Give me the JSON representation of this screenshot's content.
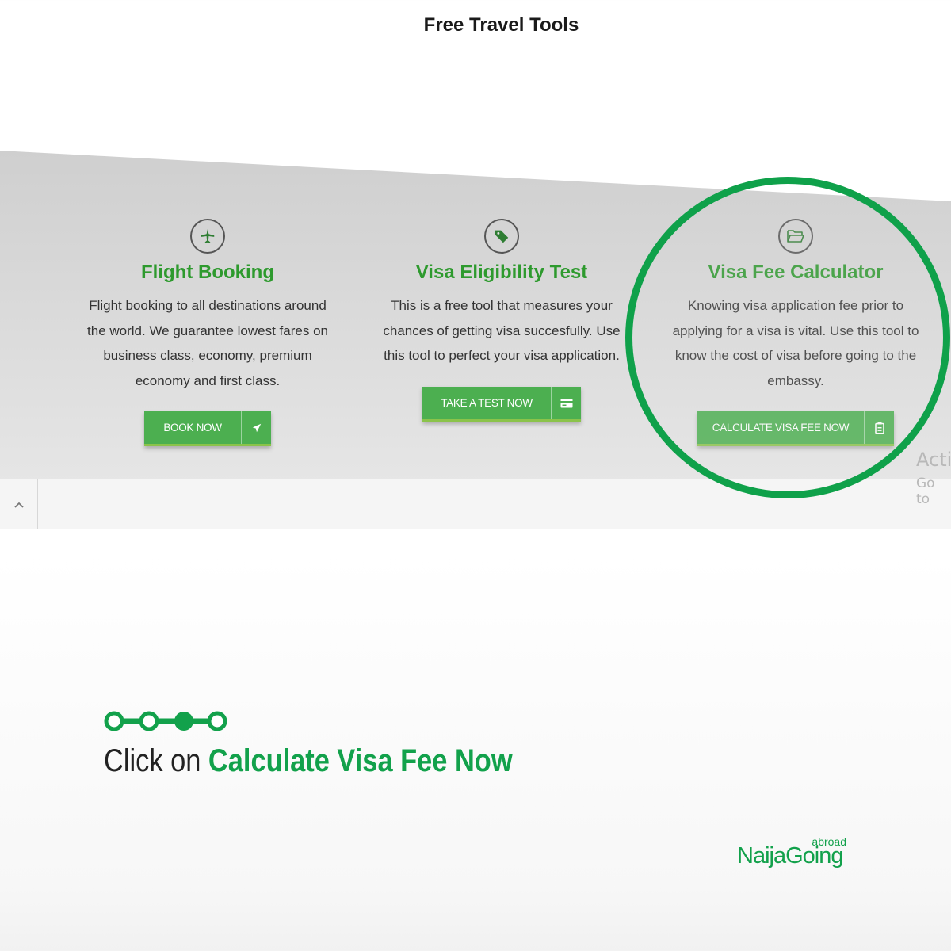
{
  "page": {
    "title": "Free Travel Tools"
  },
  "cards": [
    {
      "title": "Flight Booking",
      "description": "Flight booking to all destinations around\nthe world. We guarantee lowest fares on\nbusiness class, economy, premium\neconomy and first class.",
      "button_label": "BOOK NOW",
      "icon": "airplane-icon",
      "button_icon": "airplane-icon"
    },
    {
      "title": "Visa Eligibility Test",
      "description": "This is a free tool that measures your\nchances of getting visa succesfully. Use\nthis tool to perfect your visa application.",
      "button_label": "TAKE A TEST NOW",
      "icon": "tag-icon",
      "button_icon": "card-icon"
    },
    {
      "title": "Visa Fee Calculator",
      "description": "Knowing visa application fee prior to\napplying for a visa is vital. Use this tool to\nknow the cost of visa before going to the\nembassy.",
      "button_label": "CALCULATE VISA FEE NOW",
      "icon": "folder-open-icon",
      "button_icon": "clipboard-icon"
    }
  ],
  "watermark": {
    "line1": "Acti",
    "line2": "Go to"
  },
  "steps": {
    "total": 4,
    "current": 3
  },
  "caption": {
    "prefix": "Click on ",
    "highlight": "Calculate Visa Fee Now"
  },
  "logo": {
    "superscript": "abroad",
    "name": "NaijaGoing"
  },
  "colors": {
    "brand_green": "#12a14b",
    "button_green": "#4caf50",
    "title_green": "#2e9a2e"
  }
}
